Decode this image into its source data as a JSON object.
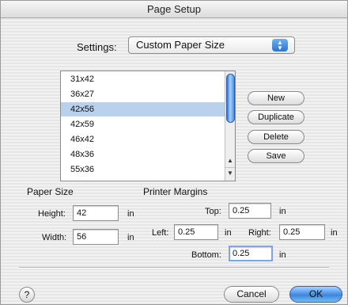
{
  "window": {
    "title": "Page Setup"
  },
  "settings": {
    "label": "Settings:",
    "value": "Custom Paper Size"
  },
  "paper_list": {
    "items": [
      "31x42",
      "36x27",
      "42x56",
      "42x59",
      "46x42",
      "48x36",
      "55x36"
    ],
    "selected": "42x56"
  },
  "buttons": {
    "new": "New",
    "duplicate": "Duplicate",
    "delete": "Delete",
    "save": "Save",
    "help": "?",
    "cancel": "Cancel",
    "ok": "OK"
  },
  "paper_size": {
    "title": "Paper Size",
    "height_label": "Height:",
    "height_value": "42",
    "height_unit": "in",
    "width_label": "Width:",
    "width_value": "56",
    "width_unit": "in"
  },
  "margins": {
    "title": "Printer Margins",
    "top_label": "Top:",
    "top_value": "0.25",
    "top_unit": "in",
    "left_label": "Left:",
    "left_value": "0.25",
    "left_unit": "in",
    "right_label": "Right:",
    "right_value": "0.25",
    "right_unit": "in",
    "bottom_label": "Bottom:",
    "bottom_value": "0.25",
    "bottom_unit": "in"
  },
  "colors": {
    "accent": "#3d86e0",
    "selection": "#b9d1ec"
  }
}
